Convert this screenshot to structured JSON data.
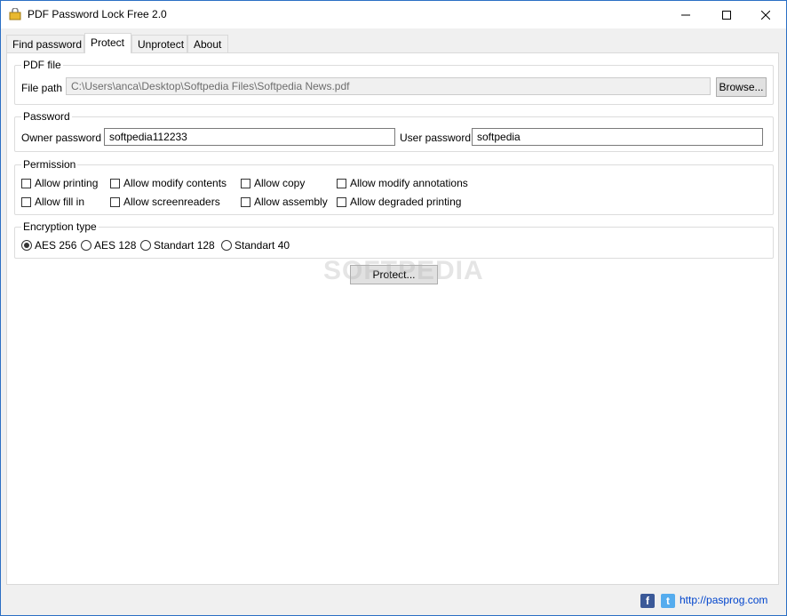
{
  "window": {
    "title": "PDF Password Lock Free 2.0"
  },
  "tabs": [
    {
      "label": "Find password"
    },
    {
      "label": "Protect"
    },
    {
      "label": "Unprotect"
    },
    {
      "label": "About"
    }
  ],
  "pdf_file": {
    "group_label": "PDF file",
    "path_label": "File path",
    "path_value": "C:\\Users\\anca\\Desktop\\Softpedia Files\\Softpedia News.pdf",
    "browse_label": "Browse..."
  },
  "password": {
    "group_label": "Password",
    "owner_label": "Owner password",
    "owner_value": "softpedia112233",
    "user_label": "User password",
    "user_value": "softpedia"
  },
  "permission": {
    "group_label": "Permission",
    "items": [
      {
        "label": "Allow printing",
        "checked": false
      },
      {
        "label": "Allow modify contents",
        "checked": false
      },
      {
        "label": "Allow copy",
        "checked": false
      },
      {
        "label": "Allow modify annotations",
        "checked": false
      },
      {
        "label": "Allow fill in",
        "checked": false
      },
      {
        "label": "Allow screenreaders",
        "checked": false
      },
      {
        "label": "Allow assembly",
        "checked": false
      },
      {
        "label": "Allow degraded printing",
        "checked": false
      }
    ]
  },
  "encryption": {
    "group_label": "Encryption type",
    "options": [
      {
        "label": "AES 256",
        "selected": true
      },
      {
        "label": "AES 128",
        "selected": false
      },
      {
        "label": "Standart 128",
        "selected": false
      },
      {
        "label": "Standart 40",
        "selected": false
      }
    ]
  },
  "protect_label": "Protect...",
  "watermark": "SOFTPEDIA",
  "footer": {
    "link": "http://pasprog.com",
    "facebook": "f",
    "twitter": "t"
  },
  "colors": {
    "accent_border": "#2b6fc4",
    "link": "#0044cc",
    "facebook": "#3b5998",
    "twitter": "#55acee"
  }
}
